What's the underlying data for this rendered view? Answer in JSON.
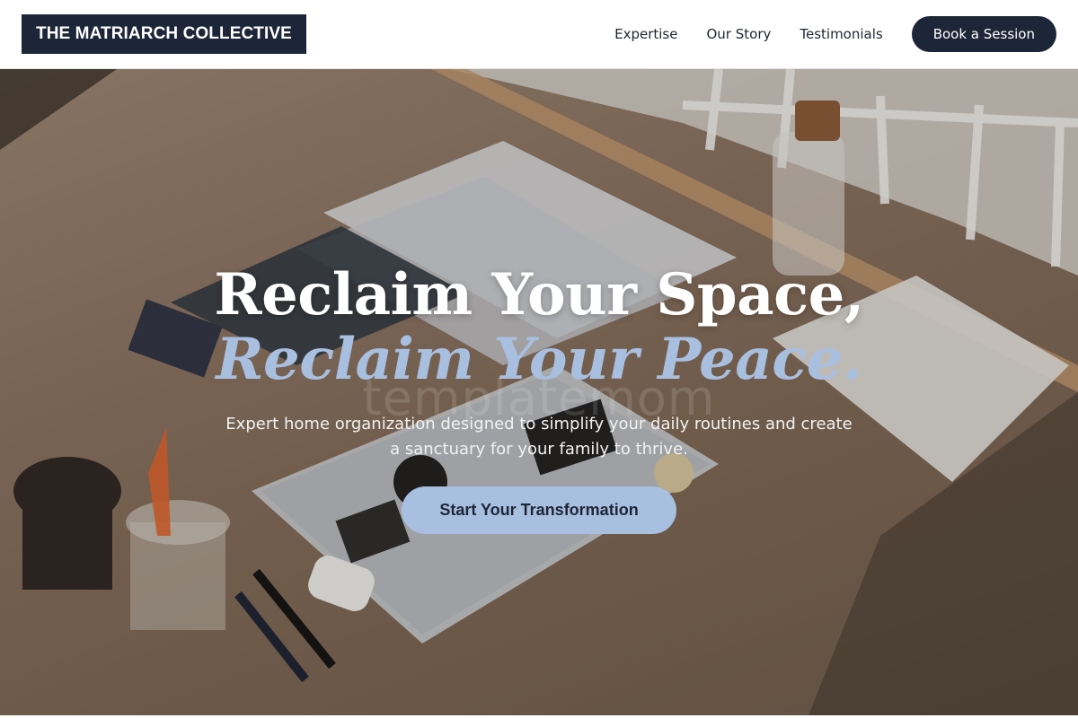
{
  "header": {
    "brand": "THE MATRIARCH COLLECTIVE",
    "nav": [
      {
        "label": "Expertise"
      },
      {
        "label": "Our Story"
      },
      {
        "label": "Testimonials"
      }
    ],
    "cta_label": "Book a Session"
  },
  "hero": {
    "headline_line1": "Reclaim Your Space,",
    "headline_line2": "Reclaim Your Peace.",
    "watermark": "templatemom",
    "subtext": "Expert home organization designed to simplify your daily routines and create a sanctuary for your family to thrive.",
    "cta_label": "Start Your Transformation"
  },
  "colors": {
    "navy": "#1c2638",
    "accent_blue": "#a9bfe0",
    "white": "#ffffff"
  }
}
